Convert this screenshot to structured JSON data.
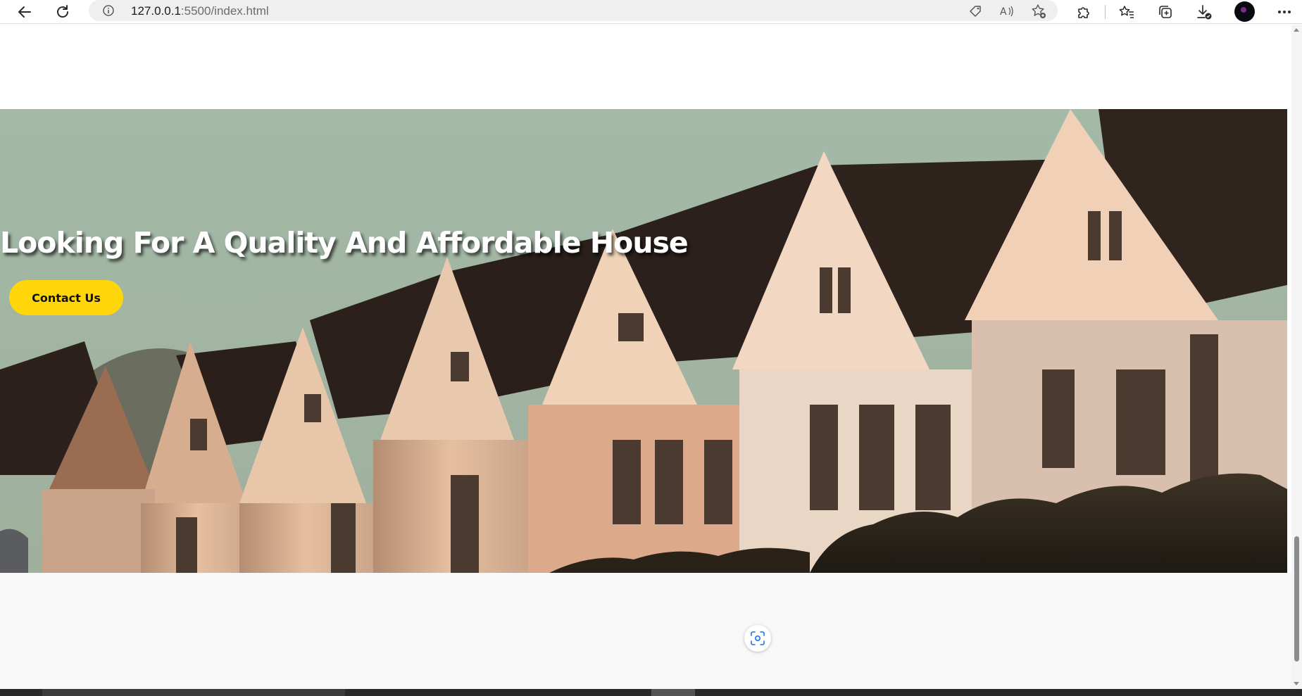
{
  "browser": {
    "url_host": "127.0.0.1",
    "url_rest": ":5500/index.html",
    "buttons": {
      "back": "back-arrow-icon",
      "refresh": "refresh-icon",
      "site_info": "info-icon",
      "coupon": "tag-icon",
      "read_aloud": "read-aloud-icon",
      "add_favorite": "star-add-icon",
      "extensions": "puzzle-icon",
      "favorites": "favorites-icon",
      "collections": "collections-icon",
      "downloads": "download-icon",
      "menu": "more-icon"
    }
  },
  "hero": {
    "title": "Looking For A Quality And Affordable House",
    "cta_label": "Contact Us"
  },
  "colors": {
    "cta": "#ffd60a",
    "title": "#ffffff",
    "sky": "#a6bbaa"
  },
  "scrollbar": {
    "position_fraction": 0.77
  }
}
